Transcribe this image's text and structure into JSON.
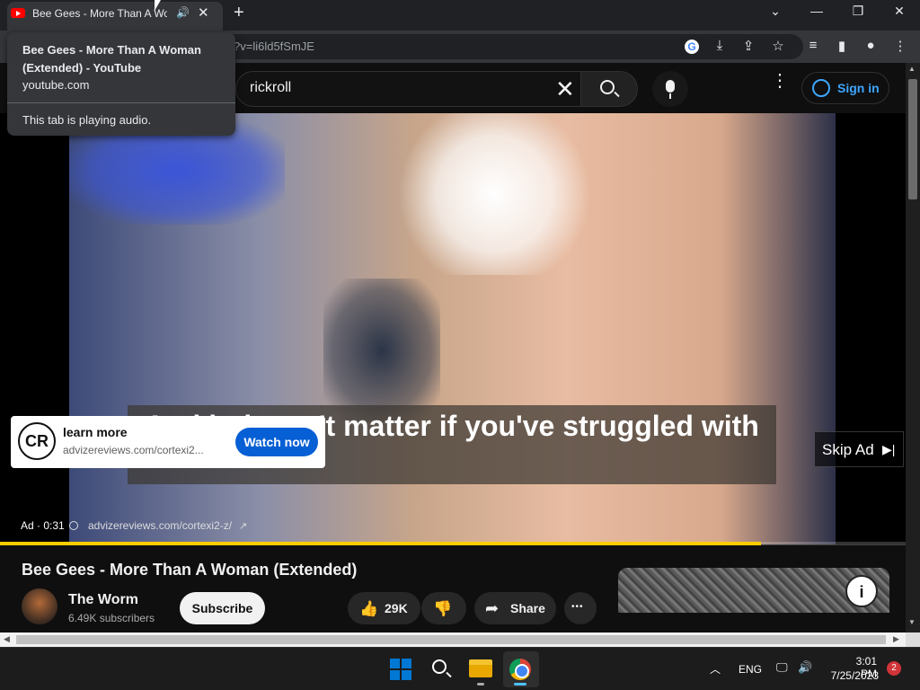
{
  "browser": {
    "tab_title": "Bee Gees - More Than A Woman",
    "tab_audio_icon": "🔊",
    "tab_close_icon": "✕",
    "new_tab_icon": "+",
    "window_controls": {
      "chevron": "⌄",
      "minimize": "—",
      "restore": "❐",
      "close": "✕"
    },
    "url": "?v=li6ld5fSmJE",
    "toolbar_icons": {
      "google": "G",
      "install": "⤓",
      "share": "⇪",
      "bookmark": "☆",
      "media": "≡",
      "sidepanel": "▮",
      "profile": "●",
      "menu": "⋮"
    }
  },
  "tooltip": {
    "title": "Bee Gees - More Than A Woman (Extended) - YouTube",
    "domain": "youtube.com",
    "audio_status": "This tab is playing audio."
  },
  "youtube": {
    "search_value": "rickroll",
    "search_clear": "✕",
    "more_menu": "⋮",
    "signin_label": "Sign in"
  },
  "ad": {
    "caption": "And it doesn't matter if you've struggled with",
    "logo_text": "CR",
    "card_title": "learn more",
    "card_domain": "advizereviews.com/cortexi2...",
    "cta": "Watch now",
    "skip_label": "Skip Ad",
    "skip_icon": "▶|",
    "time": "Ad · 0:31",
    "url": "advizereviews.com/cortexi2-z/",
    "ext_icon": "↗"
  },
  "progress_fraction": 0.84,
  "video": {
    "title": "Bee Gees - More Than A Woman (Extended)",
    "channel_name": "The Worm",
    "subscribers": "6.49K subscribers",
    "subscribe_label": "Subscribe",
    "like_icon": "👍",
    "like_count": "29K",
    "dislike_icon": "👎",
    "share_icon": "➦",
    "share_label": "Share",
    "more_icon": "•••",
    "info_icon": "i"
  },
  "scrollbars": {
    "up": "▲",
    "down": "▼",
    "left": "◀",
    "right": "▶"
  },
  "taskbar": {
    "tray_chevron": "︿",
    "language": "ENG",
    "network_icon": "🖵",
    "volume_icon": "🔊",
    "time": "3:01 PM",
    "date": "7/25/2023",
    "notification_count": "2"
  }
}
